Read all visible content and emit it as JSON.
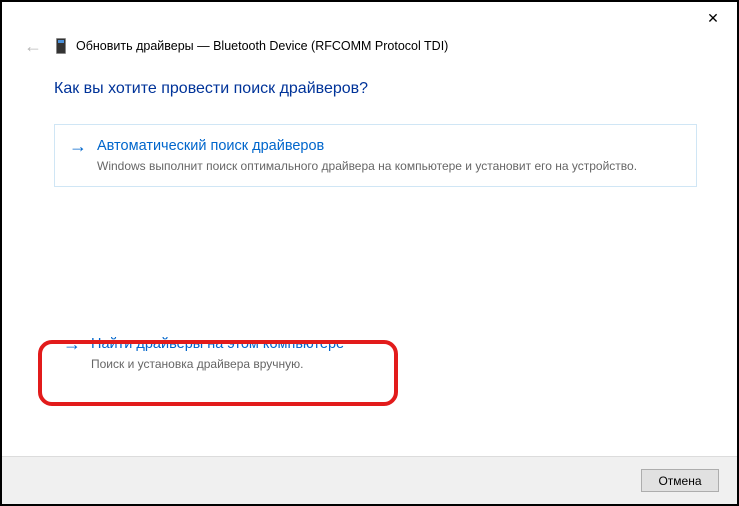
{
  "titlebar": {
    "close_symbol": "✕"
  },
  "header": {
    "back_symbol": "←",
    "title": "Обновить драйверы — Bluetooth Device (RFCOMM Protocol TDI)"
  },
  "content": {
    "heading": "Как вы хотите провести поиск драйверов?",
    "arrow_symbol": "→",
    "option_auto": {
      "title": "Автоматический поиск драйверов",
      "desc": "Windows выполнит поиск оптимального драйвера на компьютере и установит его на устройство."
    },
    "option_manual": {
      "title": "Найти драйверы на этом компьютере",
      "desc": "Поиск и установка драйвера вручную."
    }
  },
  "footer": {
    "cancel_label": "Отмена"
  }
}
